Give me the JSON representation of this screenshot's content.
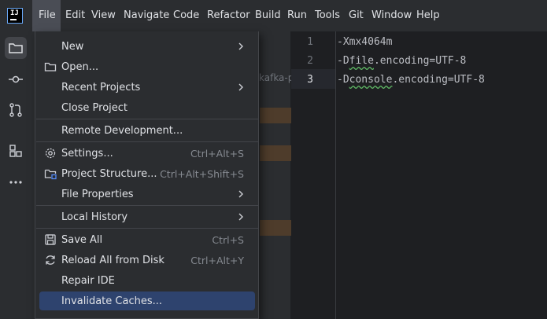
{
  "menubar": {
    "items": [
      "File",
      "Edit",
      "View",
      "Navigate",
      "Code",
      "Refactor",
      "Build",
      "Run",
      "Tools",
      "Git",
      "Window",
      "Help"
    ]
  },
  "file_menu": {
    "new": "New",
    "open": "Open...",
    "recent_projects": "Recent Projects",
    "close_project": "Close Project",
    "remote_development": "Remote Development...",
    "settings": "Settings...",
    "settings_shortcut": "Ctrl+Alt+S",
    "project_structure": "Project Structure...",
    "project_structure_shortcut": "Ctrl+Alt+Shift+S",
    "file_properties": "File Properties",
    "local_history": "Local History",
    "save_all": "Save All",
    "save_all_shortcut": "Ctrl+S",
    "reload_all": "Reload All from Disk",
    "reload_all_shortcut": "Ctrl+Alt+Y",
    "repair_ide": "Repair IDE",
    "invalidate_caches": "Invalidate Caches..."
  },
  "project_panel": {
    "faded_text": "kafka-p"
  },
  "editor": {
    "line_numbers": [
      "1",
      "2",
      "3"
    ],
    "lines": {
      "l1": "-Xmx4064m",
      "l2_dash": "-D",
      "l2_word": "file",
      "l2_rest": ".encoding=UTF-8",
      "l3_dash": "-D",
      "l3_word": "console",
      "l3_rest": ".encoding=UTF-8"
    }
  },
  "colors": {
    "background": "#1e1f22",
    "panel": "#2b2d30",
    "selection": "#2e436e",
    "accent": "#3574f0"
  }
}
